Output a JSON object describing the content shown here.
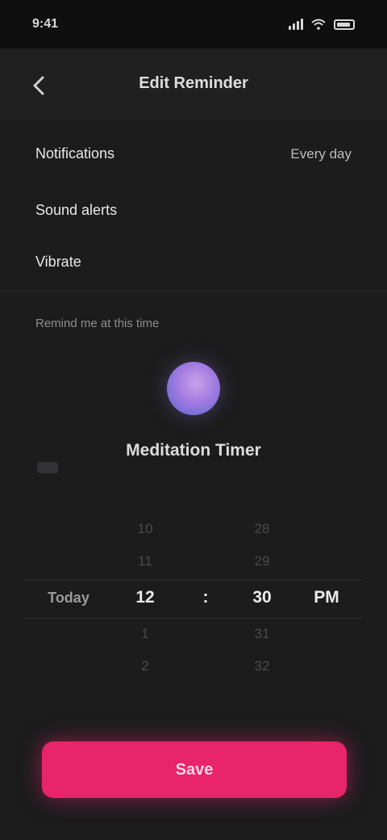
{
  "status_bar": {
    "time": "9:41"
  },
  "nav": {
    "title": "Edit Reminder"
  },
  "rows": [
    {
      "label": "Notifications",
      "value": "Every day"
    },
    {
      "label": "Sound alerts",
      "value": ""
    },
    {
      "label": "Vibrate",
      "value": ""
    }
  ],
  "section": {
    "label": "Remind me at this time"
  },
  "profile": {
    "name": "Meditation Timer"
  },
  "picker": {
    "hours": {
      "before": [
        "10",
        "11"
      ],
      "selected": "12",
      "after": [
        "1",
        "2"
      ]
    },
    "minutes": {
      "before": [
        "28",
        "29"
      ],
      "selected": "30",
      "after": [
        "31",
        "32"
      ]
    },
    "period": {
      "before": [
        "",
        ""
      ],
      "selected": "PM",
      "after": [
        "",
        ""
      ]
    },
    "prefix": {
      "before": [
        "",
        ""
      ],
      "selected": "Today",
      "after": [
        "",
        ""
      ]
    }
  },
  "button": {
    "label": "Save"
  },
  "colors": {
    "accent": "#e8246b",
    "background": "#1c1c1d",
    "avatar": "#a27ae0"
  }
}
